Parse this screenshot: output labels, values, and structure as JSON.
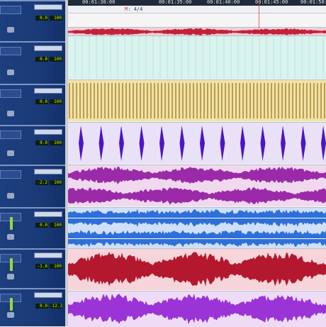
{
  "app": "Pro Tools Edit Window",
  "timeline": {
    "timecodes": [
      "00:01:30:00",
      "00:01:35:00",
      "00:01:40:00",
      "00:01:45:00",
      "00:01:50:00"
    ],
    "meter": "4/4"
  },
  "mixer": {
    "tracks": [
      {
        "vol_top": "0.0",
        "vol_bottom": "100"
      },
      {
        "vol_top": "0.0",
        "vol_bottom": "100"
      },
      {
        "vol_top": "0.0",
        "vol_bottom": "100"
      },
      {
        "vol_top": "0.0",
        "vol_bottom": "100"
      },
      {
        "vol_top": "-2.2",
        "vol_bottom": "100"
      },
      {
        "vol_top": "0.0",
        "vol_bottom": "100"
      },
      {
        "vol_top": "-1.8",
        "vol_bottom": "100"
      },
      {
        "vol_top": "0.0",
        "vol_bottom": "-12.2"
      }
    ]
  },
  "tracks": [
    {
      "name": "audio-top",
      "type": "audio",
      "bg": "#f6cfd8",
      "wave": "#c0233c"
    },
    {
      "name": "empty-mint",
      "type": "empty",
      "bg": "#d9f3ee",
      "wave": "#9fc9c2"
    },
    {
      "name": "hats",
      "type": "transients",
      "bg": "#f3e2a6",
      "wave": "#9a7a2a"
    },
    {
      "name": "kick",
      "type": "hits",
      "bg": "#e9e2f7",
      "wave": "#4b16c8"
    },
    {
      "name": "pad-stereo",
      "type": "stereo",
      "bg": "#f0d9ef",
      "wave": "#9b2aa8"
    },
    {
      "name": "guitar",
      "type": "dense",
      "bg": "#cfe0f8",
      "wave": "#2f6fd8"
    },
    {
      "name": "vocal",
      "type": "audio",
      "bg": "#f6d4da",
      "wave": "#b3182e"
    },
    {
      "name": "synth",
      "type": "audio",
      "bg": "#eedcf7",
      "wave": "#9a34d6"
    }
  ]
}
